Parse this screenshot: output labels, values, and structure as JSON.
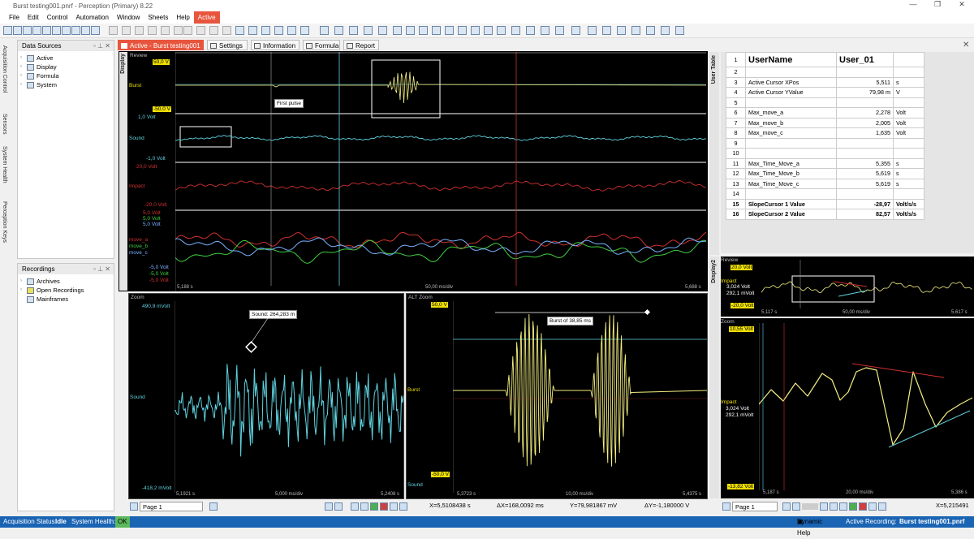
{
  "window": {
    "title": "Burst testing001.pnrf - Perception (Primary) 8.22"
  },
  "menu": [
    "File",
    "Edit",
    "Control",
    "Automation",
    "Window",
    "Sheets",
    "Help",
    "Active"
  ],
  "left_tabs": [
    "Acquisition Control",
    "Sensors",
    "System Health",
    "Perception Keys"
  ],
  "data_sources": {
    "title": "Data Sources",
    "items": [
      "Active",
      "Display",
      "Formula",
      "System"
    ]
  },
  "recordings": {
    "title": "Recordings",
    "items": [
      "Archives",
      "Open Recordings",
      "Mainframes"
    ]
  },
  "tabs": [
    "Active - Burst testing001",
    "Settings",
    "Information",
    "Formula",
    "Report"
  ],
  "display1": {
    "label": "Display",
    "review": {
      "title": "Review",
      "burst": {
        "name": "Burst",
        "top": "50,0 V",
        "bottom": "-50,0 V",
        "annotation": "First pulse"
      },
      "sound": {
        "name": "Sound",
        "top": "1,0 Volt",
        "bottom": "-1,0 Volt"
      },
      "impact": {
        "name": "Impact",
        "top": "20,0 Volt",
        "bottom": "-20,0 Volt"
      },
      "move": {
        "names": [
          "move_a",
          "move_b",
          "move_c"
        ],
        "tops": [
          "5,0 Volt",
          "5,0 Volt",
          "5,0 Volt"
        ],
        "bottoms": [
          "-5,0 Volt",
          "-5,0 Volt",
          "-5,0 Volt"
        ]
      },
      "x_start": "5,188 s",
      "x_div": "50,00 ms/div",
      "x_end": "5,688 s"
    },
    "zoom": {
      "title": "Zoom",
      "channel": "Sound",
      "top": "490,9 mVolt",
      "bottom": "-418,2 mVolt",
      "annotation": "Sound: 264,283 m",
      "x_start": "5,1921 s",
      "x_div": "5,000 ms/div",
      "x_end": "5,2408 s"
    },
    "alt_zoom": {
      "title": "ALT Zoom",
      "channel": "Burst",
      "channel2": "Sound",
      "top": "50,0 V",
      "bottom": "-50,0 V",
      "annotation": "Burst of 38,85 ms",
      "x_start": "5,3723 s",
      "x_div": "10,00 ms/div",
      "x_end": "5,4375 s"
    }
  },
  "user_table": {
    "label": "User Table",
    "header": {
      "num": "1",
      "name": "UserName",
      "value": "User_01"
    },
    "rows": [
      {
        "n": "2",
        "name": "",
        "value": "",
        "unit": ""
      },
      {
        "n": "3",
        "name": "Active Cursor XPos",
        "value": "5,511",
        "unit": "s"
      },
      {
        "n": "4",
        "name": "Active Cursor YValue",
        "value": "79,98 m",
        "unit": "V"
      },
      {
        "n": "5",
        "name": "",
        "value": "",
        "unit": ""
      },
      {
        "n": "6",
        "name": "Max_move_a",
        "value": "2,278",
        "unit": "Volt"
      },
      {
        "n": "7",
        "name": "Max_move_b",
        "value": "2,005",
        "unit": "Volt"
      },
      {
        "n": "8",
        "name": "Max_move_c",
        "value": "1,635",
        "unit": "Volt"
      },
      {
        "n": "9",
        "name": "",
        "value": "",
        "unit": ""
      },
      {
        "n": "10",
        "name": "",
        "value": "",
        "unit": ""
      },
      {
        "n": "11",
        "name": "Max_Time_Move_a",
        "value": "5,355",
        "unit": "s"
      },
      {
        "n": "12",
        "name": "Max_Time_Move_b",
        "value": "5,619",
        "unit": "s"
      },
      {
        "n": "13",
        "name": "Max_Time_Move_c",
        "value": "5,619",
        "unit": "s"
      },
      {
        "n": "14",
        "name": "",
        "value": "",
        "unit": ""
      },
      {
        "n": "15",
        "name": "SlopeCursor 1 Value",
        "value": "-28,97",
        "unit": "Volt/s/s",
        "bold": true
      },
      {
        "n": "16",
        "name": "SlopeCursor 2 Value",
        "value": "82,57",
        "unit": "Volt/s/s",
        "bold": true
      }
    ]
  },
  "display2": {
    "label": "Display2",
    "review": {
      "title": "Review",
      "channel": "Impact",
      "top": "20,0 Volt",
      "bottom": "-20,0 Volt",
      "cursor1": "3,024 Volt",
      "cursor2": "292,1 mVolt",
      "x_start": "5,117 s",
      "x_div": "50,00 ms/div",
      "x_end": "5,617 s"
    },
    "zoom": {
      "title": "Zoom",
      "channel": "Impact",
      "top": "10,55 Volt",
      "bottom": "-13,82 Volt",
      "cursor1": "3,024 Volt",
      "cursor2": "292,1 mVolt",
      "x_start": "5,187 s",
      "x_div": "20,00 ms/div",
      "x_end": "5,386 s"
    }
  },
  "nav": {
    "page1": "Page 1",
    "page2": "Page 1"
  },
  "readouts": {
    "x": "X=5,5108438 s",
    "dx": "ΔX=168,0092 ms",
    "y": "Y=79,981867 mV",
    "dy": "ΔY=-1,180000 V",
    "x2": "X=5,215491"
  },
  "status": {
    "acq_label": "Acquisition Status:",
    "acq": "Idle",
    "health_label": "System Health:",
    "health": "OK",
    "dynamic_help": "Dynamic Help",
    "active_recording_label": "Active Recording:",
    "active_recording": "Burst testing001.pnrf"
  },
  "colors": {
    "cyan": "#5fd3e0",
    "yellow": "#f5f080",
    "red": "#d03030",
    "green": "#3fcf3f",
    "blue": "#7ab2ff",
    "accent": "#e8553d"
  }
}
